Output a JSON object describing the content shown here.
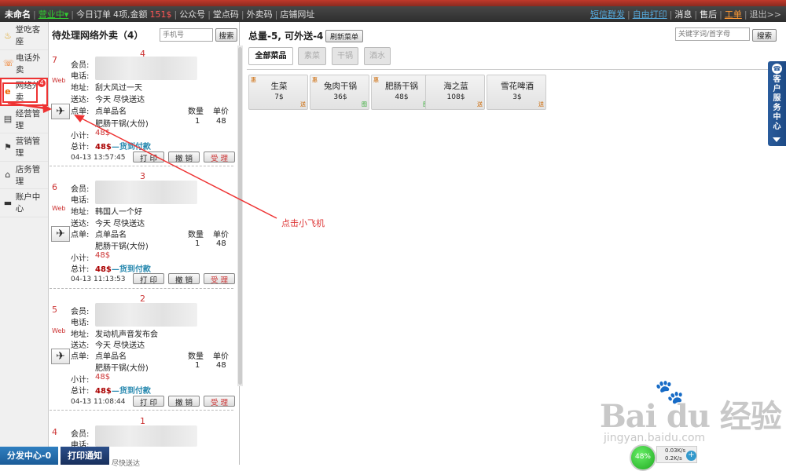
{
  "topbar": {
    "app_name": "未命名",
    "business_status": "营业中▾",
    "today_orders": "今日订单",
    "order_count": "4项,金额",
    "amount": "151$",
    "public_account": "公众号",
    "hall_order": "堂点码",
    "takeout_code": "外卖码",
    "store_url": "店铺网址",
    "sms": "短信群发",
    "self_print": "自由打印",
    "message": "消息",
    "after_sale": "售后",
    "work_order": "工单",
    "exit": "退出>>"
  },
  "sidebar": {
    "items": [
      {
        "label": "堂吃客座",
        "icon": "dining-icon",
        "glyph": "♨"
      },
      {
        "label": "电话外卖",
        "icon": "phone-icon",
        "glyph": "☏"
      },
      {
        "label": "网络外卖",
        "icon": "ie-icon",
        "glyph": "e",
        "badge": "4"
      },
      {
        "label": "经营管理",
        "icon": "ledger-icon",
        "glyph": "▤"
      },
      {
        "label": "营销管理",
        "icon": "flag-icon",
        "glyph": "⚑"
      },
      {
        "label": "店务管理",
        "icon": "house-icon",
        "glyph": "⌂"
      },
      {
        "label": "账户中心",
        "icon": "card-icon",
        "glyph": "▬"
      }
    ]
  },
  "orders_panel": {
    "title": "待处理网络外卖（4）",
    "phone_placeholder": "手机号",
    "search_label": "搜索",
    "labels": {
      "member": "会员:",
      "phone": "电话:",
      "address": "地址:",
      "delivery": "送达:",
      "order": "点单:",
      "item_name": "点单品名",
      "qty": "数量",
      "price": "单价",
      "subtotal": "小计:",
      "total": "总计:",
      "print": "打 印",
      "cancel": "撤 销",
      "accept": "受 理"
    },
    "orders": [
      {
        "num": "7",
        "seq": "4",
        "source": "Web",
        "address": "刮大风过一天",
        "delivery": "今天 尽快送达",
        "item": "肥肠干锅(大份)",
        "qty": "1",
        "price": "48",
        "subtotal": "48$",
        "total": "48$",
        "pay": "—货到付款",
        "time": "04-13 13:57:45"
      },
      {
        "num": "6",
        "seq": "3",
        "source": "Web",
        "address": "韩国人一个好",
        "delivery": "今天 尽快送达",
        "item": "肥肠干锅(大份)",
        "qty": "1",
        "price": "48",
        "subtotal": "48$",
        "total": "48$",
        "pay": "—货到付款",
        "time": "04-13 11:13:53"
      },
      {
        "num": "5",
        "seq": "2",
        "source": "Web",
        "address": "发动机声音发布会",
        "delivery": "今天 尽快送达",
        "item": "肥肠干锅(大份)",
        "qty": "1",
        "price": "48",
        "subtotal": "48$",
        "total": "48$",
        "pay": "—货到付款",
        "time": "04-13 11:08:44"
      },
      {
        "num": "4",
        "seq": "1",
        "delivery_partial": "尽快送达"
      }
    ]
  },
  "menu": {
    "summary": "总量-5, 可外送-4",
    "refresh_label": "刷新菜单",
    "keyword_placeholder": "关键字词/首字母",
    "search_label": "搜索",
    "tabs": [
      "全部菜品",
      "素菜",
      "干锅",
      "酒水"
    ],
    "dishes": [
      {
        "mark": "惠",
        "name": "生菜",
        "price": "7$",
        "ship": "送",
        "ship_color": "a"
      },
      {
        "mark": "惠",
        "name": "兔肉干锅",
        "price": "36$",
        "ship": "图",
        "ship_color": "b"
      },
      {
        "mark": "惠",
        "name": "肥肠干锅",
        "price": "48$",
        "ship": "图",
        "ship_color": "b"
      },
      {
        "mark": "",
        "name": "海之蓝",
        "price": "108$",
        "ship": "送",
        "ship_color": "a"
      },
      {
        "mark": "",
        "name": "雪花啤酒",
        "price": "3$",
        "ship": "送",
        "ship_color": "a"
      }
    ]
  },
  "customer_service": {
    "text": "客户服务中心"
  },
  "annotation": {
    "text": "点击小飞机"
  },
  "footer": {
    "dispatch": "分发中心-0",
    "print_notice": "打印通知"
  },
  "net_widget": {
    "percent": "48%",
    "up": "0.03K/s",
    "down": "0.2K/s"
  },
  "watermark": {
    "brand": "Bai du 经验",
    "url": "jingyan.baidu.com"
  },
  "colors": {
    "accent_red": "#e33",
    "pay_blue": "#2a8ab0",
    "topbar_bg": "#3a3a3a",
    "footer_blue": "#1b5c98"
  }
}
